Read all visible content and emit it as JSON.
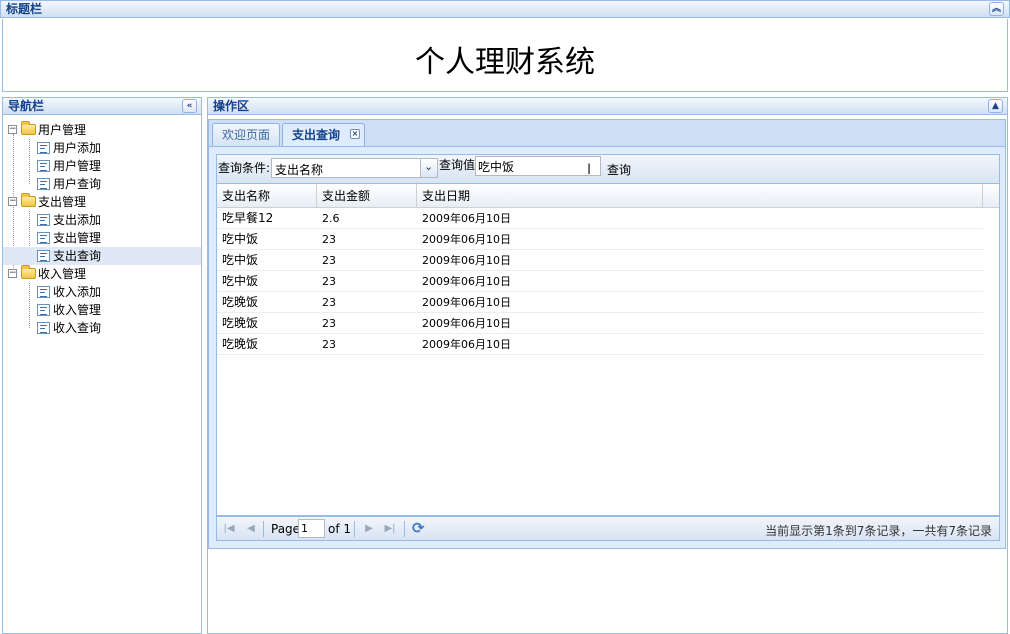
{
  "title_panel": {
    "header": "标题栏",
    "collapse_icon": "double-chevron-up-icon"
  },
  "app_title": "个人理财系统",
  "nav_panel": {
    "header": "导航栏",
    "collapse_icon": "double-chevron-left-icon",
    "groups": [
      {
        "label": "用户管理",
        "items": [
          "用户添加",
          "用户管理",
          "用户查询"
        ]
      },
      {
        "label": "支出管理",
        "items": [
          "支出添加",
          "支出管理",
          "支出查询"
        ]
      },
      {
        "label": "收入管理",
        "items": [
          "收入添加",
          "收入管理",
          "收入查询"
        ]
      }
    ],
    "selected": "支出查询"
  },
  "work_panel": {
    "header": "操作区",
    "collapse_icon": "chevron-up-icon"
  },
  "tabs": [
    {
      "label": "欢迎页面",
      "active": false,
      "closable": false
    },
    {
      "label": "支出查询",
      "active": true,
      "closable": true
    }
  ],
  "query": {
    "condition_label": "查询条件:",
    "condition_value": "支出名称",
    "value_label": "查询值",
    "value_input": "吃中饭",
    "button_label": "查询"
  },
  "grid": {
    "columns": [
      "支出名称",
      "支出金额",
      "支出日期"
    ],
    "rows": [
      [
        "吃早餐12",
        "2.6",
        "2009年06月10日"
      ],
      [
        "吃中饭",
        "23",
        "2009年06月10日"
      ],
      [
        "吃中饭",
        "23",
        "2009年06月10日"
      ],
      [
        "吃中饭",
        "23",
        "2009年06月10日"
      ],
      [
        "吃晚饭",
        "23",
        "2009年06月10日"
      ],
      [
        "吃晚饭",
        "23",
        "2009年06月10日"
      ],
      [
        "吃晚饭",
        "23",
        "2009年06月10日"
      ]
    ]
  },
  "pager": {
    "page_label": "Page",
    "page_value": "1",
    "of_label": "of 1",
    "status": "当前显示第1条到7条记录，一共有7条记录"
  },
  "colors": {
    "header_text": "#15428b",
    "border": "#99bbe8",
    "tab_strip": "#cedff5",
    "selection": "#dfe8f6"
  }
}
